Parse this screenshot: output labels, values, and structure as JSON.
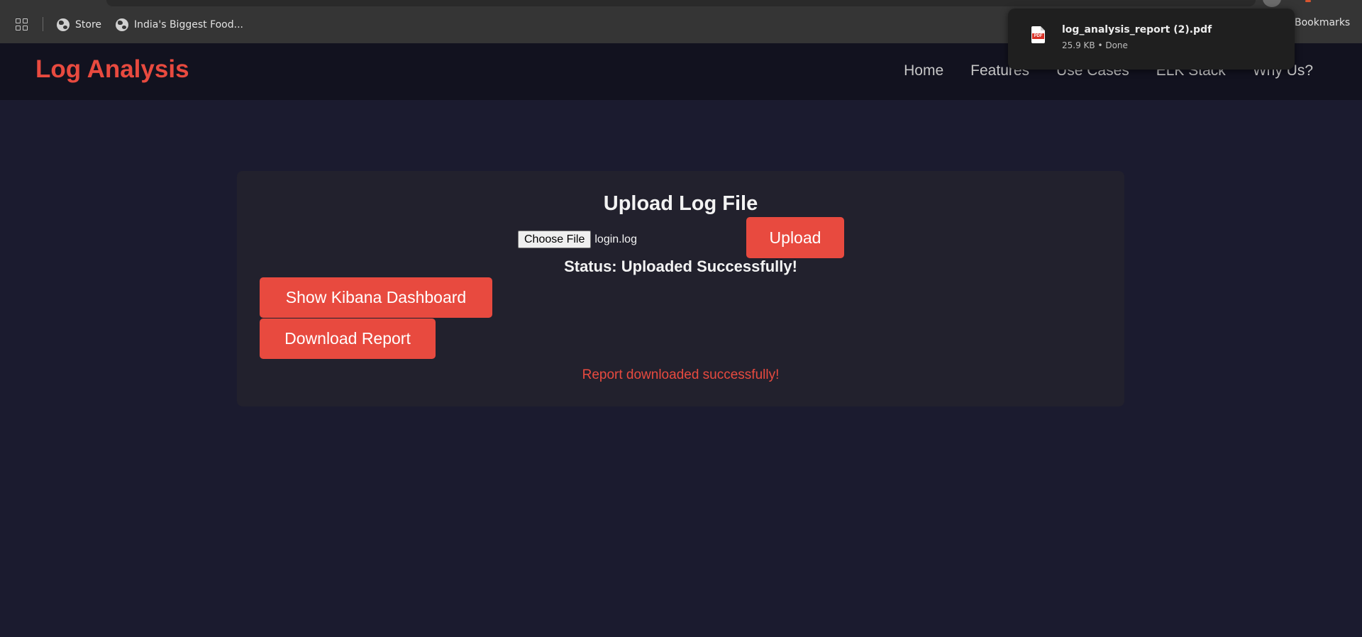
{
  "browser": {
    "bookmarks": [
      {
        "icon": "globe-icon",
        "label": "Store"
      },
      {
        "icon": "globe-icon",
        "label": "India's Biggest Food..."
      }
    ],
    "all_bookmarks_label": "Bookmarks",
    "download": {
      "file_name": "log_analysis_report (2).pdf",
      "meta": "25.9 KB • Done",
      "icon": "pdf-file-icon",
      "icon_text": "PDF"
    }
  },
  "site": {
    "logo": "Log Analysis",
    "nav": [
      "Home",
      "Features",
      "Use Cases",
      "ELK Stack",
      "Why Us?"
    ]
  },
  "upload": {
    "title": "Upload Log File",
    "choose_file_label": "Choose File",
    "file_name": "login.log",
    "upload_label": "Upload",
    "status": "Status: Uploaded Successfully!",
    "kibana_label": "Show Kibana Dashboard",
    "download_label": "Download Report",
    "report_message": "Report downloaded successfully!"
  },
  "colors": {
    "accent": "#e84a3f",
    "page_bg": "#1b1b2f",
    "nav_bg": "#12121f",
    "card_bg": "#22212d"
  }
}
